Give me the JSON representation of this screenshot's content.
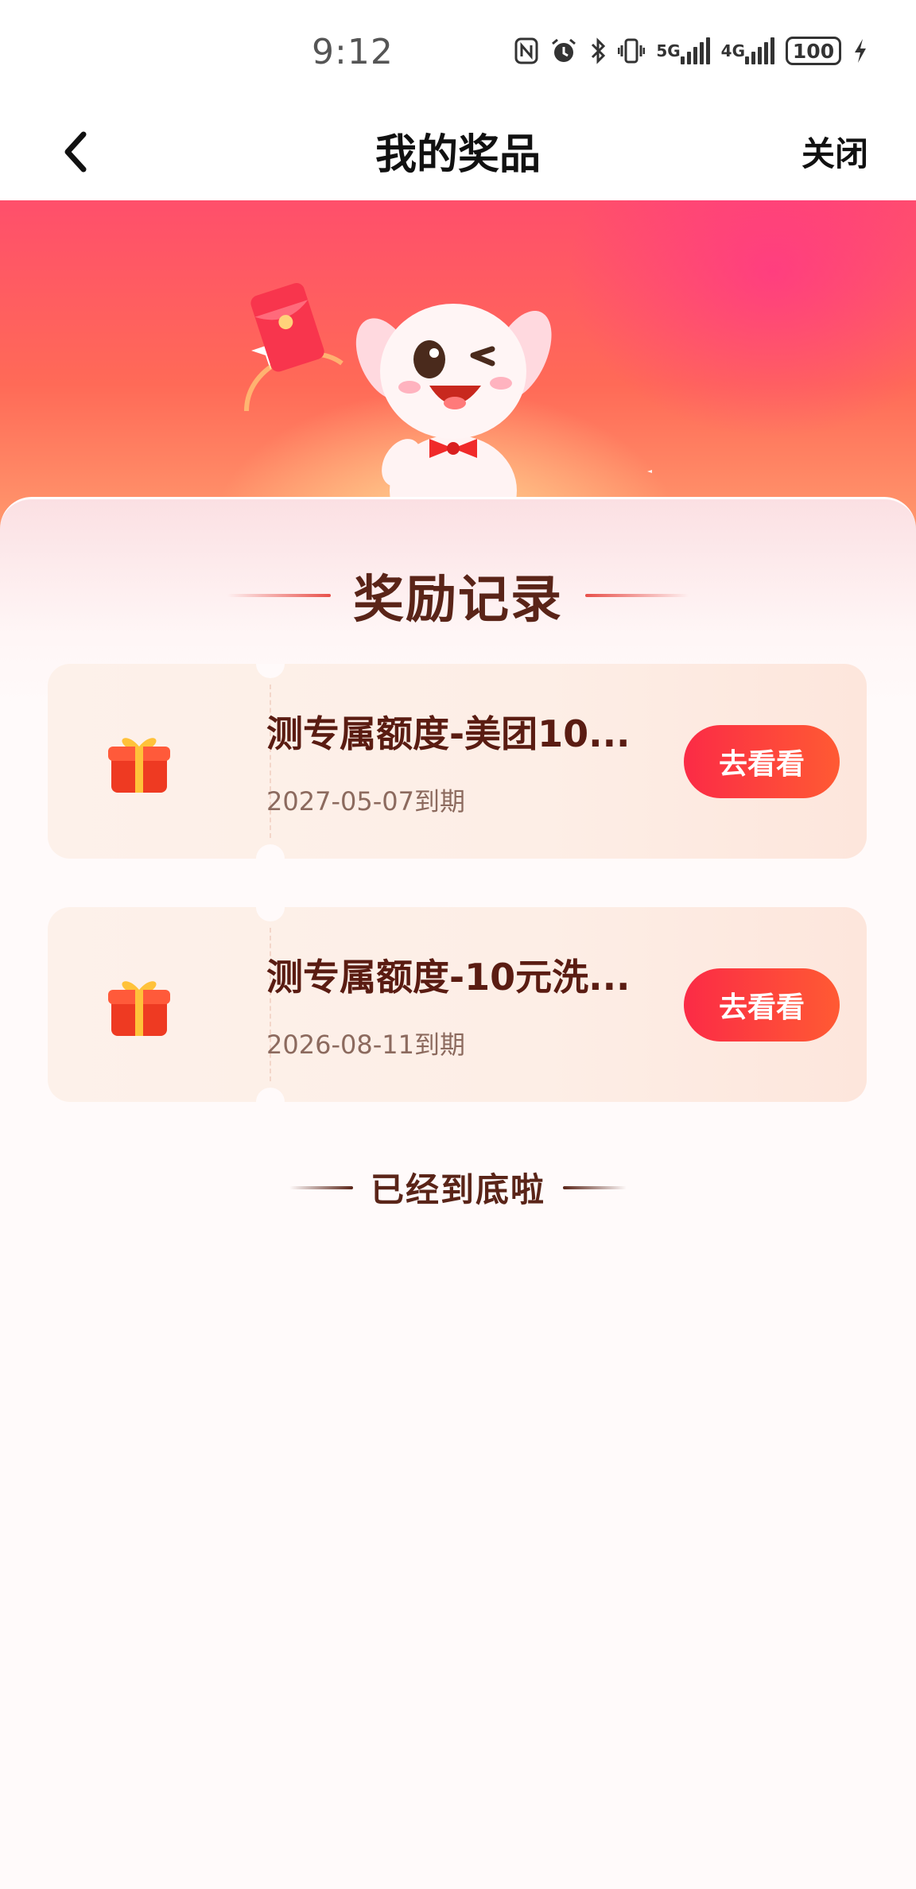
{
  "status_bar": {
    "time": "9:12",
    "network_5g": "5G",
    "network_4g": "4G",
    "battery": "100",
    "icons": [
      "nfc-icon",
      "alarm-icon",
      "bluetooth-icon",
      "vibrate-icon",
      "signal-5g-icon",
      "signal-4g-icon",
      "battery-icon",
      "charging-icon"
    ]
  },
  "nav": {
    "title": "我的奖品",
    "close_label": "关闭"
  },
  "section": {
    "title": "奖励记录"
  },
  "rewards": [
    {
      "title": "测专属额度-美团10...",
      "expiry": "2027-05-07到期",
      "action": "去看看"
    },
    {
      "title": "测专属额度-10元洗...",
      "expiry": "2026-08-11到期",
      "action": "去看看"
    }
  ],
  "end_text": "已经到底啦",
  "colors": {
    "accent": "#fb2b46",
    "accent_end": "#ff5a33",
    "title_brown": "#5a2418",
    "banner_pink": "#ff4f6b"
  }
}
